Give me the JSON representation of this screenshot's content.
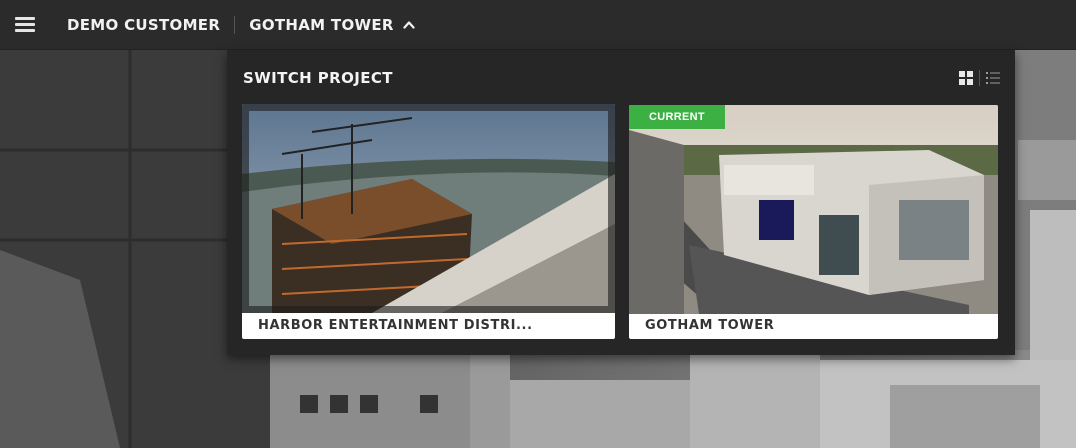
{
  "nav": {
    "customer": "DEMO CUSTOMER",
    "project": "GOTHAM TOWER"
  },
  "panel": {
    "title": "SWITCH PROJECT"
  },
  "projects": [
    {
      "name": "HARBOR ENTERTAINMENT DISTRI...",
      "current": false
    },
    {
      "name": "GOTHAM TOWER",
      "current": true,
      "badge": "CURRENT"
    }
  ],
  "icons": {
    "menu": "hamburger-icon",
    "chevron": "chevron-up-icon",
    "grid": "grid-view-icon",
    "list": "list-view-icon"
  },
  "colors": {
    "badge": "#3cb043",
    "topbar": "#2b2b2b",
    "panel": "#262626"
  }
}
